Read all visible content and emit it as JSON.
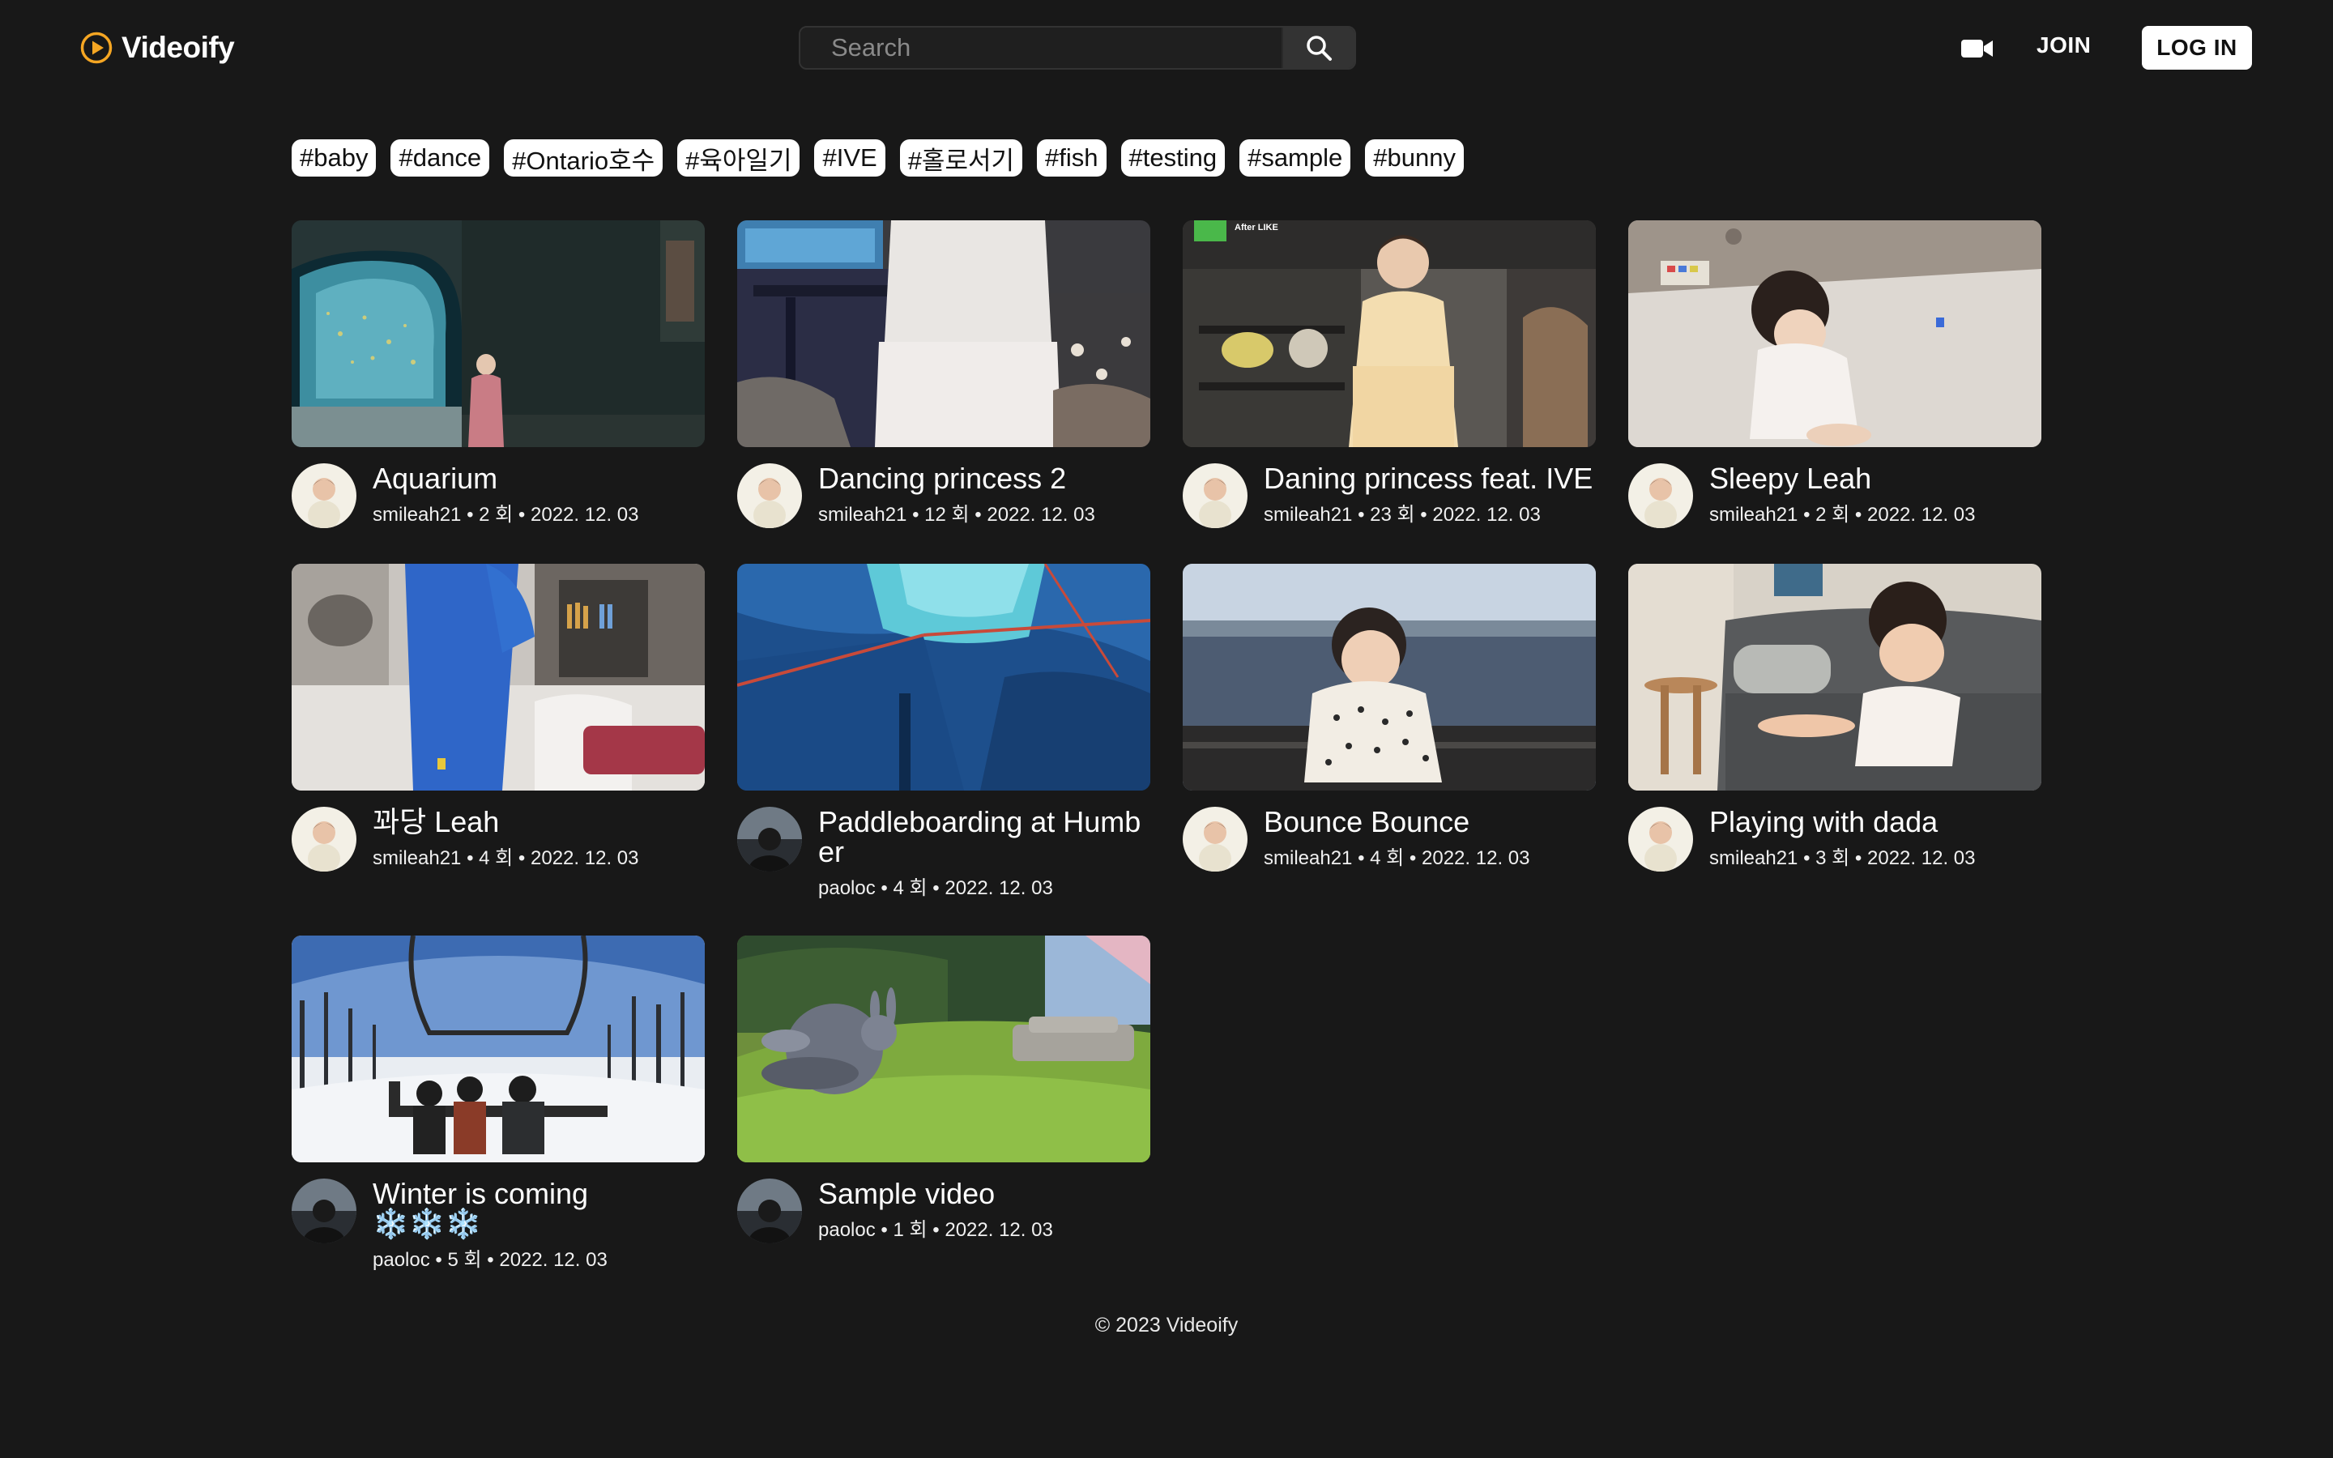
{
  "app": {
    "name": "Videoify"
  },
  "header": {
    "search_placeholder": "Search",
    "join_label": "JOIN",
    "login_label": "LOG IN"
  },
  "tags": [
    "#baby",
    "#dance",
    "#Ontario호수",
    "#육아일기",
    "#IVE",
    "#홀로서기",
    "#fish",
    "#testing",
    "#sample",
    "#bunny"
  ],
  "videos": [
    {
      "title": "Aquarium",
      "owner": "smileah21",
      "views": "2 회",
      "date": "2022. 12. 03"
    },
    {
      "title": "Dancing princess 2",
      "owner": "smileah21",
      "views": "12 회",
      "date": "2022. 12. 03"
    },
    {
      "title": "Daning princess feat. IVE",
      "owner": "smileah21",
      "views": "23 회",
      "date": "2022. 12. 03",
      "overlay": "After LIKE"
    },
    {
      "title": "Sleepy Leah",
      "owner": "smileah21",
      "views": "2 회",
      "date": "2022. 12. 03"
    },
    {
      "title": "꽈당 Leah",
      "owner": "smileah21",
      "views": "4 회",
      "date": "2022. 12. 03"
    },
    {
      "title": "Paddleboarding at Humber",
      "owner": "paoloc",
      "views": "4 회",
      "date": "2022. 12. 03"
    },
    {
      "title": "Bounce Bounce",
      "owner": "smileah21",
      "views": "4 회",
      "date": "2022. 12. 03"
    },
    {
      "title": "Playing with dada",
      "owner": "smileah21",
      "views": "3 회",
      "date": "2022. 12. 03"
    },
    {
      "title": "Winter is coming ❄️❄️❄️",
      "owner": "paoloc",
      "views": "5 회",
      "date": "2022. 12. 03"
    },
    {
      "title": "Sample video",
      "owner": "paoloc",
      "views": "1 회",
      "date": "2022. 12. 03"
    }
  ],
  "footer": {
    "text": "© 2023 Videoify"
  },
  "colors": {
    "background": "#181818",
    "accent": "#f5a623"
  }
}
